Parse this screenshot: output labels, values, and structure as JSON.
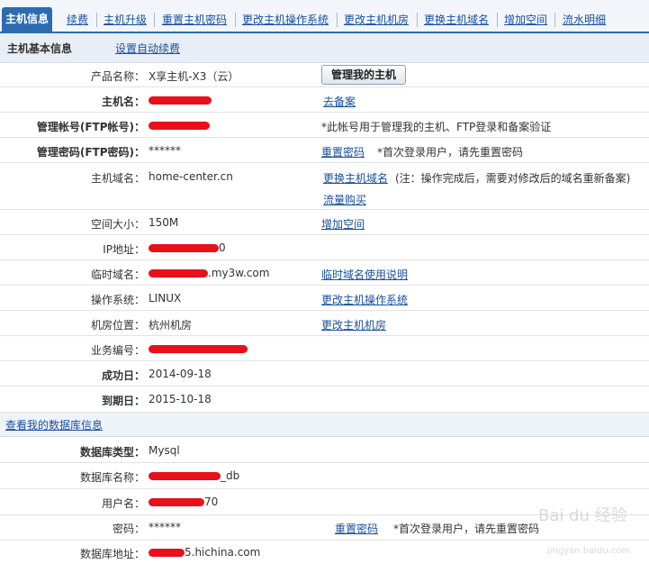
{
  "tabs": [
    "主机信息",
    "续费",
    "主机升级",
    "重置主机密码",
    "更改主机操作系统",
    "更改主机机房",
    "更换主机域名",
    "增加空间",
    "流水明细"
  ],
  "section": {
    "title": "主机基本信息",
    "auto_renew": "设置自动续费"
  },
  "manage_button": "管理我的主机",
  "rows": {
    "product": {
      "label": "产品名称：",
      "value": "X享主机-X3（云）"
    },
    "hostname": {
      "label": "主机名：",
      "action": "去备案"
    },
    "ftp_account": {
      "label": "管理帐号(FTP帐号)：",
      "note": "*此帐号用于管理我的主机、FTP登录和备案验证"
    },
    "ftp_password": {
      "label": "管理密码(FTP密码)：",
      "value": "******",
      "action": "重置密码",
      "note": "*首次登录用户，请先重置密码"
    },
    "domain": {
      "label": "主机域名：",
      "value": "home-center.cn",
      "action": "更换主机域名",
      "note": "(注：操作完成后，需要对修改后的域名重新备案)",
      "action2": "流量购买"
    },
    "space": {
      "label": "空间大小：",
      "value": "150M",
      "action": "增加空间"
    },
    "ip": {
      "label": "IP地址：",
      "value_tail": "0"
    },
    "temp_domain": {
      "label": "临时域名：",
      "value_tail": ".my3w.com",
      "action": "临时域名使用说明"
    },
    "os": {
      "label": "操作系统：",
      "value": "LINUX",
      "action": "更改主机操作系统"
    },
    "room": {
      "label": "机房位置：",
      "value": "杭州机房",
      "action": "更改主机机房"
    },
    "biz_no": {
      "label": "业务编号："
    },
    "start_date": {
      "label": "成功日：",
      "value": "2014-09-18"
    },
    "end_date": {
      "label": "到期日：",
      "value": "2015-10-18"
    }
  },
  "db": {
    "link": "查看我的数据库信息",
    "type": {
      "label": "数据库类型：",
      "value": "Mysql"
    },
    "name": {
      "label": "数据库名称：",
      "value_tail": "_db"
    },
    "user": {
      "label": "用户名：",
      "value_tail": "70"
    },
    "password": {
      "label": "密码：",
      "value": "******",
      "action": "重置密码",
      "note": "*首次登录用户，请先重置密码"
    },
    "address": {
      "label": "数据库地址：",
      "value_tail": "5.hichina.com"
    }
  },
  "watermark": {
    "logo": "Bai du 经验",
    "url": "jingyan.baidu.com"
  },
  "colors": {
    "tab_active": "#2d6bb0",
    "link": "#1a4fa0",
    "redaction": "#e8101a"
  }
}
